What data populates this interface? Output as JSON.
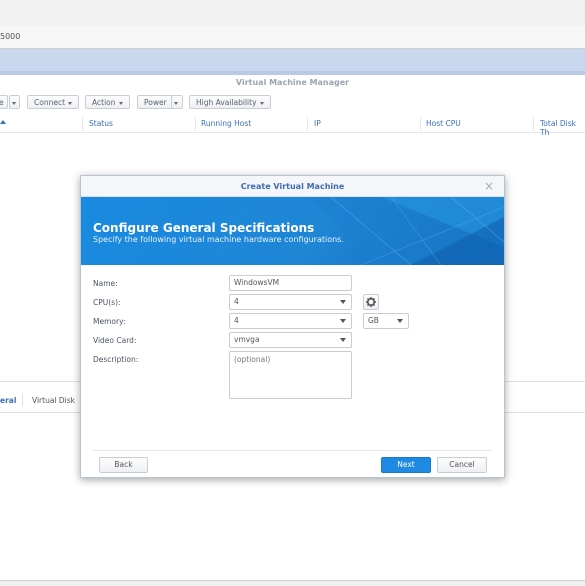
{
  "browser": {
    "url_fragment": "5000"
  },
  "app": {
    "window_title": "Virtual Machine Manager"
  },
  "toolbar": {
    "first_label": "e",
    "connect": "Connect",
    "action": "Action",
    "power": "Power",
    "ha": "High Availability"
  },
  "list": {
    "columns": [
      "Status",
      "Running Host",
      "IP",
      "Host CPU",
      "Total Disk Th"
    ]
  },
  "bottom_tabs": {
    "general": "eral",
    "virtual_disk": "Virtual Disk"
  },
  "dialog": {
    "title": "Create Virtual Machine",
    "close": "×",
    "heading": "Configure General Specifications",
    "subheading": "Specify the following virtual machine hardware configurations.",
    "name_label": "Name:",
    "name_value": "WindowsVM",
    "cpu_label": "CPU(s):",
    "cpu_value": "4",
    "memory_label": "Memory:",
    "memory_value": "4",
    "memory_unit": "GB",
    "video_label": "Video Card:",
    "video_value": "vmvga",
    "description_label": "Description:",
    "description_placeholder": "(optional)",
    "back": "Back",
    "next": "Next",
    "cancel": "Cancel"
  },
  "colors": {
    "accent": "#1f8ae4",
    "title_blue": "#3e6cb3",
    "banner": "#1a8ae0"
  }
}
